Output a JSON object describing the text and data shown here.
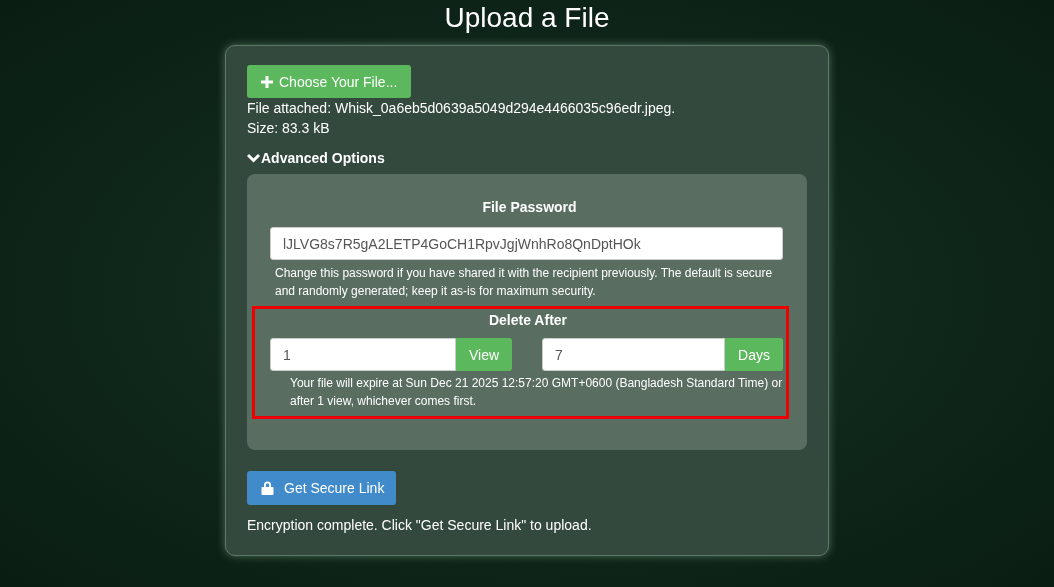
{
  "title": "Upload a File",
  "choose_button": {
    "label": "Choose Your File..."
  },
  "file_info": {
    "attached": "File attached: Whisk_0a6eb5d0639a5049d294e4466035c96edr.jpeg.",
    "size": "Size: 83.3 kB"
  },
  "advanced_options": {
    "label": "Advanced Options",
    "expanded": true,
    "password": {
      "label": "File Password",
      "value": "lJLVG8s7R5gA2LETP4GoCH1RpvJgjWnhRo8QnDptHOk",
      "help": "Change this password if you have shared it with the recipient previously. The default is secure and randomly generated; keep it as-is for maximum security."
    },
    "delete_after": {
      "label": "Delete After",
      "highlighted": true,
      "fields": [
        {
          "value": "1",
          "unit": "View"
        },
        {
          "value": "7",
          "unit": "Days"
        }
      ],
      "help": "Your file will expire at Sun Dec 21 2025 12:57:20 GMT+0600 (Bangladesh Standard Time) or after 1 view, whichever comes first."
    }
  },
  "secure_link_button": {
    "label": "Get Secure Link"
  },
  "status": "Encryption complete. Click \"Get Secure Link\" to upload."
}
